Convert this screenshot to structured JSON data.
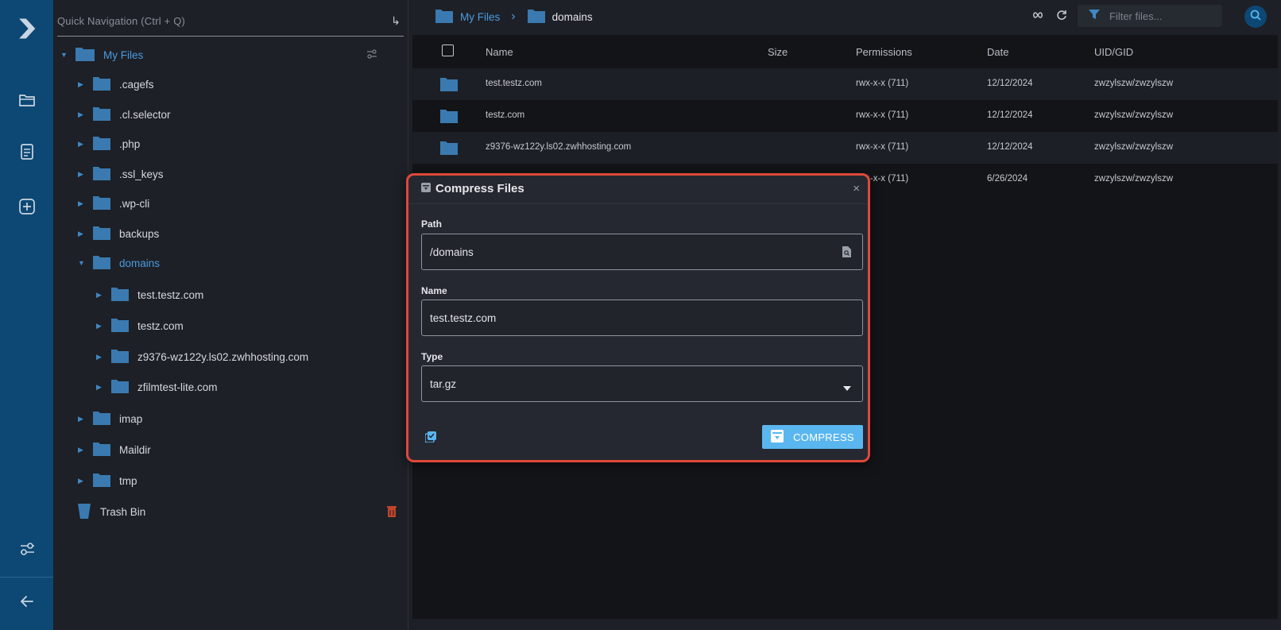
{
  "tree": {
    "quick_nav_placeholder": "Quick Navigation (Ctrl + Q)",
    "quick_nav_enter": "↳",
    "root": "My Files",
    "items": [
      {
        "label": ".cagefs"
      },
      {
        "label": ".cl.selector"
      },
      {
        "label": ".php"
      },
      {
        "label": ".ssl_keys"
      },
      {
        "label": ".wp-cli"
      },
      {
        "label": "backups"
      },
      {
        "label": "domains"
      },
      {
        "label": "test.testz.com"
      },
      {
        "label": "testz.com"
      },
      {
        "label": "z9376-wz122y.ls02.zwhhosting.com"
      },
      {
        "label": "zfilmtest-lite.com"
      },
      {
        "label": "imap"
      },
      {
        "label": "Maildir"
      },
      {
        "label": "tmp"
      }
    ],
    "trash": "Trash Bin"
  },
  "breadcrumb": {
    "root": "My Files",
    "current": "domains",
    "separator": "›"
  },
  "toolbar": {
    "filter_placeholder": "Filter files..."
  },
  "table": {
    "headers": [
      "Name",
      "Size",
      "Permissions",
      "Date",
      "UID/GID"
    ],
    "rows": [
      {
        "name": "test.testz.com",
        "size": "",
        "permissions": "rwx-x-x (711)",
        "date": "12/12/2024",
        "uid": "zwzylszw/zwzylszw"
      },
      {
        "name": "testz.com",
        "size": "",
        "permissions": "rwx-x-x (711)",
        "date": "12/12/2024",
        "uid": "zwzylszw/zwzylszw"
      },
      {
        "name": "z9376-wz122y.ls02.zwhhosting.com",
        "size": "",
        "permissions": "rwx-x-x (711)",
        "date": "12/12/2024",
        "uid": "zwzylszw/zwzylszw"
      },
      {
        "name": "",
        "size": "",
        "permissions": "rwx-x-x (711)",
        "date": "6/26/2024",
        "uid": "zwzylszw/zwzylszw"
      }
    ]
  },
  "dialog": {
    "title": "Compress Files",
    "close": "×",
    "path_label": "Path",
    "path_value": "/domains",
    "name_label": "Name",
    "name_value": "test.testz.com",
    "type_label": "Type",
    "type_value": "tar.gz",
    "compress_label": "COMPRESS"
  },
  "colors": {
    "rail": "#0d4874",
    "accent": "#4a9be0",
    "folder": "#3a7ab0",
    "highlight": "#e0483a",
    "button": "#5ab6ef"
  }
}
